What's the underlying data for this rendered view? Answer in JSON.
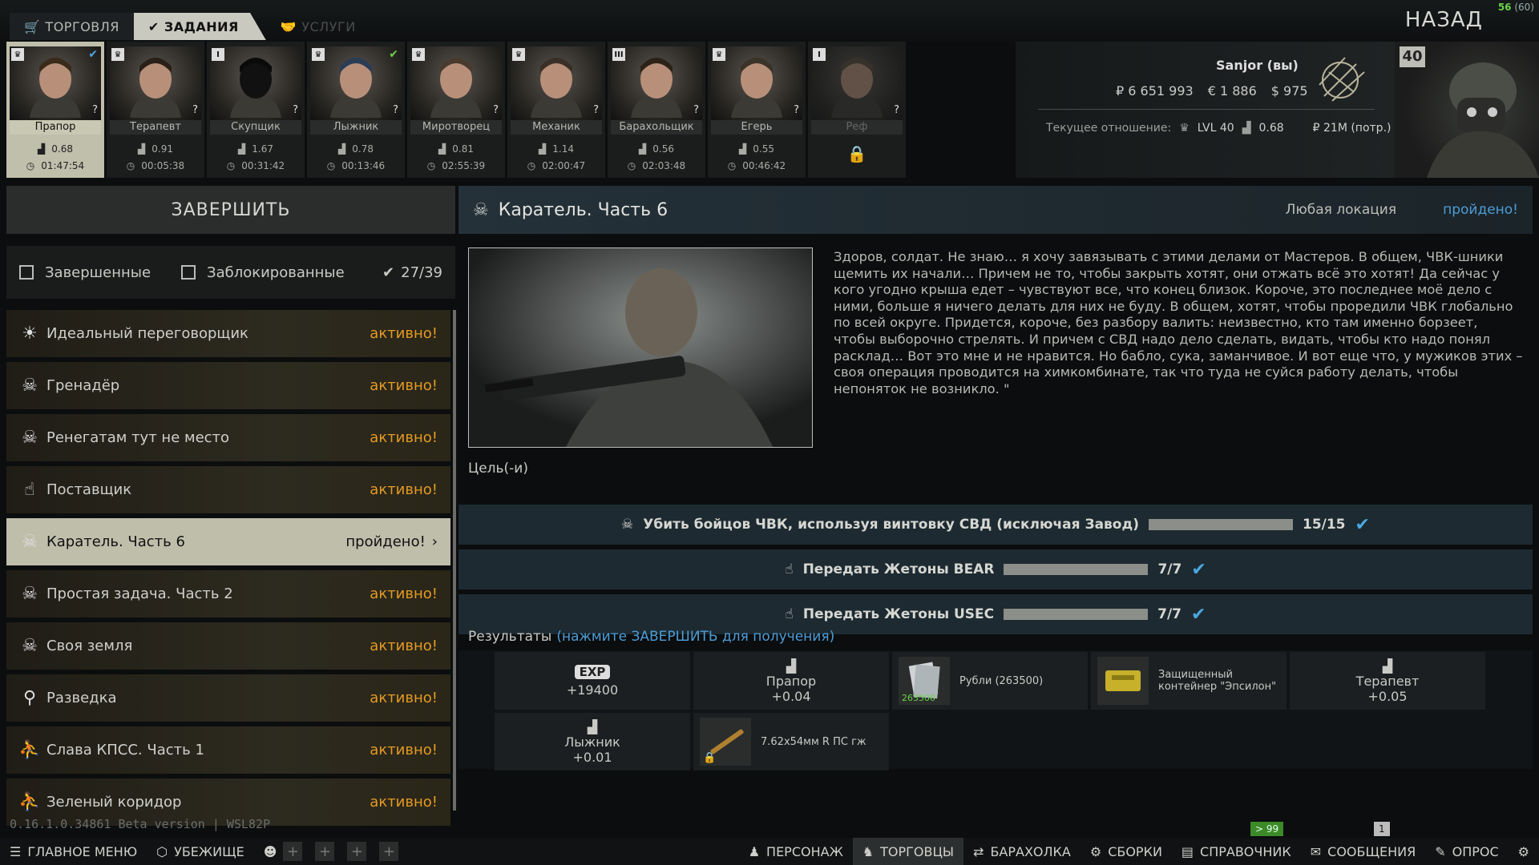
{
  "topbar": {
    "tab_trade": "ТОРГОВЛЯ",
    "tab_tasks": "ЗАДАНИЯ",
    "tab_services": "УСЛУГИ",
    "back": "НАЗАД",
    "fps": "56",
    "fps_max": "(60)"
  },
  "traders": [
    {
      "name": "Прапор",
      "rep": "0.68",
      "time": "01:47:54",
      "level": "crown",
      "check": true
    },
    {
      "name": "Терапевт",
      "rep": "0.91",
      "time": "00:05:38",
      "level": "crown",
      "check": false
    },
    {
      "name": "Скупщик",
      "rep": "1.67",
      "time": "00:31:42",
      "level": "I",
      "check": false
    },
    {
      "name": "Лыжник",
      "rep": "0.78",
      "time": "00:13:46",
      "level": "crown",
      "check": true
    },
    {
      "name": "Миротворец",
      "rep": "0.81",
      "time": "02:55:39",
      "level": "crown",
      "check": false
    },
    {
      "name": "Механик",
      "rep": "1.14",
      "time": "02:00:47",
      "level": "crown",
      "check": false
    },
    {
      "name": "Барахольщик",
      "rep": "0.56",
      "time": "02:03:48",
      "level": "III",
      "check": false
    },
    {
      "name": "Егерь",
      "rep": "0.55",
      "time": "00:46:42",
      "level": "crown",
      "check": false
    },
    {
      "name": "Реф",
      "rep": "",
      "time": "",
      "level": "I",
      "check": false,
      "locked": true
    }
  ],
  "profile": {
    "name": "Sanjor (вы)",
    "rubles": "₽ 6 651 993",
    "euros": "€ 1 886",
    "dollars": "$ 975",
    "relation_label": "Текущее отношение:",
    "lvl": "LVL 40",
    "rep": "0.68",
    "spent": "₽ 21M (потр.)",
    "level_badge": "40"
  },
  "left": {
    "complete_button": "ЗАВЕРШИТЬ",
    "filter_completed": "Завершенные",
    "filter_locked": "Заблокированные",
    "count": "27/39",
    "version": "0.16.1.0.34861 Beta version | WSL82P"
  },
  "quests": [
    {
      "title": "Идеальный переговорщик",
      "status": "активно!",
      "icon": "lightbulb-icon"
    },
    {
      "title": "Гренадёр",
      "status": "активно!",
      "icon": "skull-icon"
    },
    {
      "title": "Ренегатам тут не место",
      "status": "активно!",
      "icon": "skull-icon"
    },
    {
      "title": "Поставщик",
      "status": "активно!",
      "icon": "hand-icon"
    },
    {
      "title": "Каратель. Часть 6",
      "status": "пройдено!",
      "icon": "skull-icon",
      "selected": true
    },
    {
      "title": "Простая задача. Часть 2",
      "status": "активно!",
      "icon": "skull-icon"
    },
    {
      "title": "Своя земля",
      "status": "активно!",
      "icon": "skull-icon"
    },
    {
      "title": "Разведка",
      "status": "активно!",
      "icon": "magnifier-icon"
    },
    {
      "title": "Слава КПСС. Часть 1",
      "status": "активно!",
      "icon": "runner-icon"
    },
    {
      "title": "Зеленый коридор",
      "status": "активно!",
      "icon": "runner-icon"
    }
  ],
  "detail": {
    "title": "Каратель. Часть 6",
    "location": "Любая локация",
    "status": "пройдено!",
    "description": "Здоров, солдат. Не знаю… я хочу завязывать с этими делами от Мастеров. В общем, ЧВК-шники щемить их начали… Причем не то, чтобы закрыть хотят, они отжать всё это хотят! Да сейчас у кого угодно крыша едет – чувствуют все, что конец близок. Короче, это последнее моё дело с ними, больше я ничего делать для них не буду. В общем, хотят, чтобы проредили ЧВК глобально по всей округе. Придется, короче, без разбору валить: неизвестно, кто там именно борзеет, чтобы выборочно стрелять. И причем с СВД надо дело сделать, видать, чтобы кто надо понял расклад… Вот это мне и не нравится. Но бабло, сука, заманчивое. И вот еще что, у мужиков этих – своя операция проводится на химкомбинате, так что туда  не суйся работу делать, чтобы непоняток не возникло. \"",
    "goals_label": "Цель(-и)",
    "results_label": "Результаты",
    "results_hint": "(нажмите ЗАВЕРШИТЬ для получения)"
  },
  "goals": [
    {
      "text": "Убить бойцов ЧВК, используя винтовку СВД (исключая Завод)",
      "progress": "15/15",
      "fraction": 1.0,
      "icon": "skull-icon"
    },
    {
      "text": "Передать Жетоны BEAR",
      "progress": "7/7",
      "fraction": 1.0,
      "icon": "hand-icon"
    },
    {
      "text": "Передать Жетоны USEC",
      "progress": "7/7",
      "fraction": 1.0,
      "icon": "hand-icon"
    }
  ],
  "rewards": {
    "exp_label": "EXP",
    "exp_value": "+19400",
    "rep1_name": "Прапор",
    "rep1_value": "+0.04",
    "rubles_label": "Рубли (263500)",
    "rubles_stack": "263500",
    "container_label": "Защищенный контейнер \"Эпсилон\"",
    "rep2_name": "Терапевт",
    "rep2_value": "+0.05",
    "rep3_name": "Лыжник",
    "rep3_value": "+0.01",
    "ammo_label": "7.62x54мм R ПС гж"
  },
  "bottombar": {
    "main_menu": "ГЛАВНОЕ МЕНЮ",
    "hideout": "УБЕЖИЩЕ",
    "character": "ПЕРСОНАЖ",
    "traders": "ТОРГОВЦЫ",
    "flea": "БАРАХОЛКА",
    "builds": "СБОРКИ",
    "handbook": "СПРАВОЧНИК",
    "messages": "СООБЩЕНИЯ",
    "survey": "ОПРОС",
    "badge_msgs": "> 99",
    "badge_other": "1"
  },
  "colors": {
    "accent_blue": "#4d9dd6",
    "active_orange": "#e49a24",
    "selected_bg": "#bfbeab"
  }
}
